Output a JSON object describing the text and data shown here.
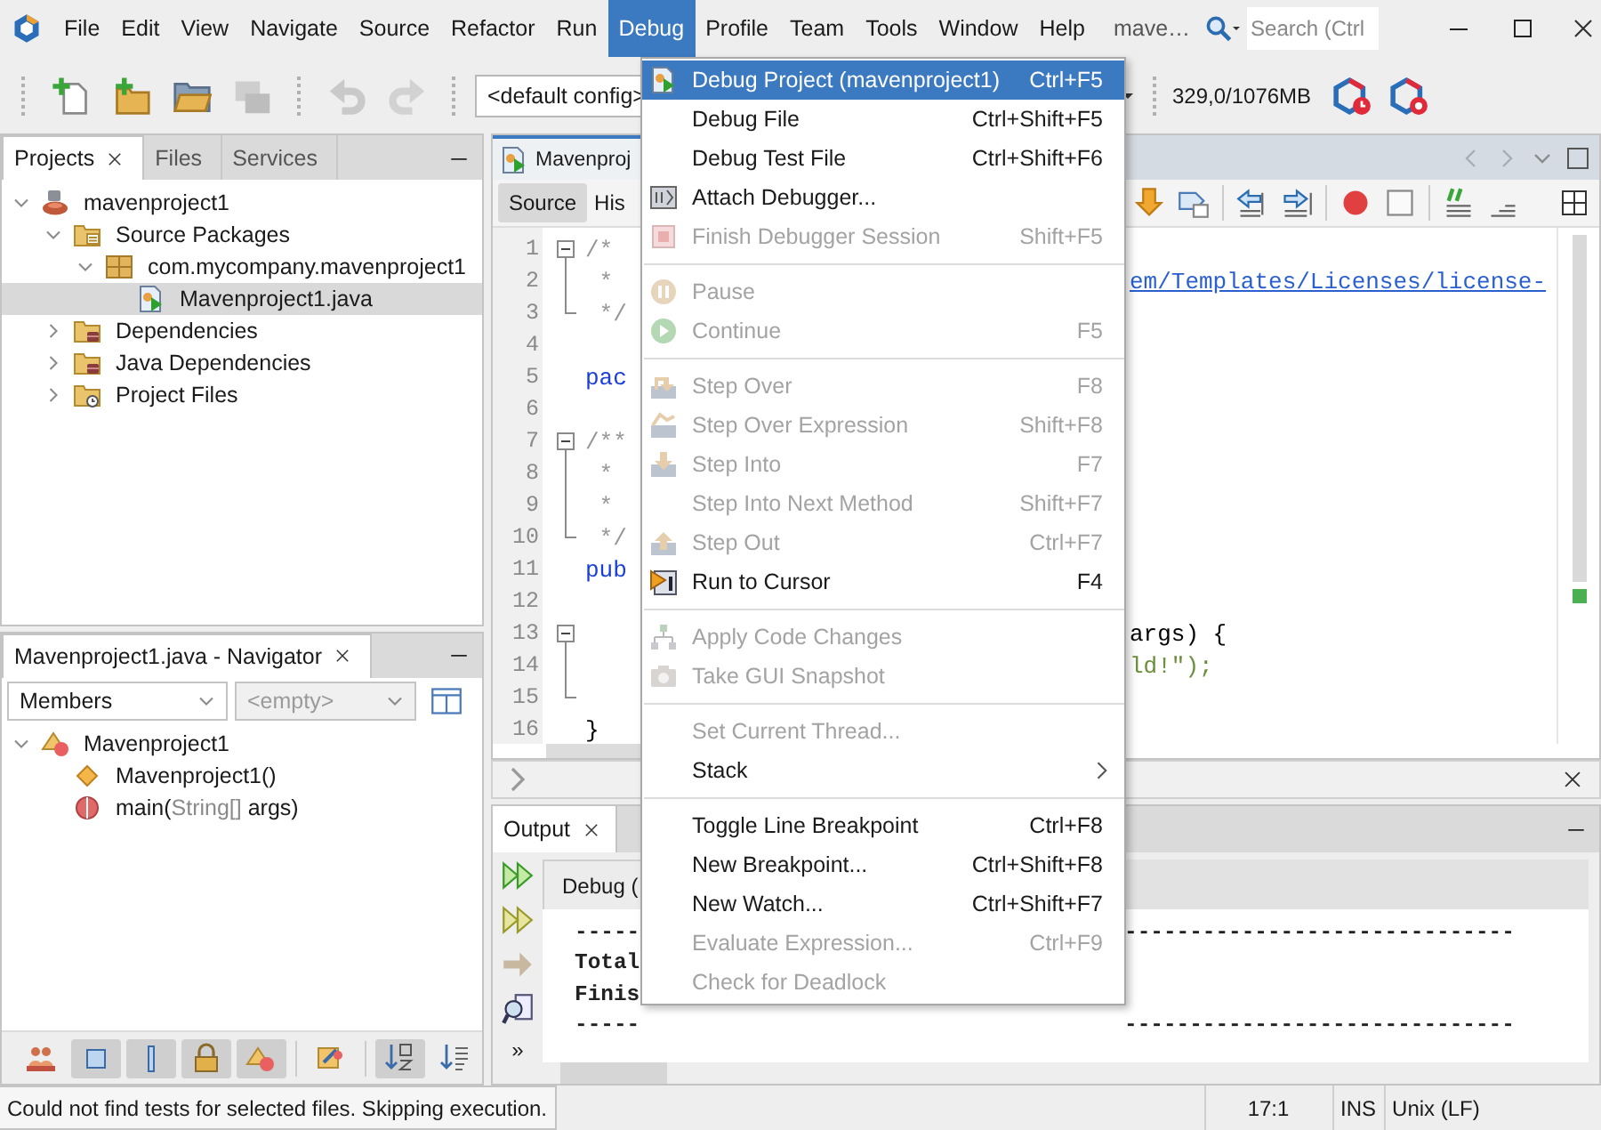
{
  "menubar": {
    "items": [
      {
        "label": "File",
        "selected": false
      },
      {
        "label": "Edit",
        "selected": false
      },
      {
        "label": "View",
        "selected": false
      },
      {
        "label": "Navigate",
        "selected": false
      },
      {
        "label": "Source",
        "selected": false
      },
      {
        "label": "Refactor",
        "selected": false
      },
      {
        "label": "Run",
        "selected": false
      },
      {
        "label": "Debug",
        "selected": true
      },
      {
        "label": "Profile",
        "selected": false
      },
      {
        "label": "Team",
        "selected": false
      },
      {
        "label": "Tools",
        "selected": false
      },
      {
        "label": "Window",
        "selected": false
      },
      {
        "label": "Help",
        "selected": false
      }
    ],
    "project_label": "mave…",
    "search": {
      "placeholder": "Search (Ctrl"
    }
  },
  "toolbar": {
    "buttons": [
      {
        "disabled": false
      },
      {
        "disabled": false
      },
      {
        "disabled": false
      },
      {
        "disabled": true
      },
      {
        "disabled": true
      },
      {
        "disabled": true
      }
    ],
    "config": "<default config>",
    "memory": "329,0/1076MB"
  },
  "projects_panel": {
    "tabs": [
      {
        "label": "Projects",
        "selected": true
      },
      {
        "label": "Files",
        "selected": false
      },
      {
        "label": "Services",
        "selected": false
      }
    ],
    "tree": [
      {
        "label": "mavenproject1",
        "kind": "project",
        "expanded": true,
        "selected": false,
        "children": [
          {
            "label": "Source Packages",
            "kind": "source-folder",
            "expanded": true,
            "selected": false,
            "children": [
              {
                "label": "com.mycompany.mavenproject1",
                "kind": "package",
                "expanded": true,
                "selected": false,
                "children": [
                  {
                    "label": "Mavenproject1.java",
                    "kind": "java-file",
                    "selected": true
                  }
                ]
              }
            ]
          },
          {
            "label": "Dependencies",
            "kind": "library-folder",
            "expanded": false,
            "selected": false
          },
          {
            "label": "Java Dependencies",
            "kind": "library-folder",
            "expanded": false,
            "selected": false
          },
          {
            "label": "Project Files",
            "kind": "config-folder",
            "expanded": false,
            "selected": false
          }
        ]
      }
    ]
  },
  "navigator": {
    "title": "Mavenproject1.java - Navigator",
    "filter": {
      "value": "Members",
      "disabled": false
    },
    "filter2": {
      "value": "<empty>",
      "disabled": true
    },
    "tree": [
      {
        "label": "Mavenproject1",
        "kind": "class",
        "expanded": true,
        "selected": false,
        "children": [
          {
            "label": "Mavenproject1()",
            "kind": "constructor",
            "selected": false
          },
          {
            "label": "main(",
            "param_type": "String[]",
            "param_rest": " args)",
            "kind": "method",
            "selected": false
          }
        ]
      }
    ],
    "tool_buttons": [
      {
        "on": false
      },
      {
        "on": true
      },
      {
        "on": true
      },
      {
        "on": true
      },
      {
        "on": true
      },
      {
        "on": false
      },
      {
        "on": true
      },
      {
        "on": false
      }
    ]
  },
  "editor": {
    "tab": "Mavenproj",
    "views": [
      {
        "label": "Source",
        "selected": true
      },
      {
        "label": "His",
        "selected": false
      }
    ],
    "lines": [
      {
        "number": "1",
        "kind": "fold-start",
        "left": {
          "text": "/*",
          "kind": "comment"
        }
      },
      {
        "number": "2",
        "kind": "fold-body",
        "left": {
          "text": " *",
          "kind": "comment"
        },
        "right": {
          "text": "em/Templates/Licenses/license-",
          "kind": "link"
        }
      },
      {
        "number": "3",
        "kind": "fold-end",
        "left": {
          "text": " */",
          "kind": "comment"
        }
      },
      {
        "number": "4",
        "kind": "plain"
      },
      {
        "number": "5",
        "kind": "plain",
        "left": {
          "text": "pac",
          "kind": "keyword"
        }
      },
      {
        "number": "6",
        "kind": "plain"
      },
      {
        "number": "7",
        "kind": "fold-start",
        "left": {
          "text": "/**",
          "kind": "comment"
        }
      },
      {
        "number": "8",
        "kind": "fold-body",
        "left": {
          "text": " *",
          "kind": "comment"
        }
      },
      {
        "number": "9",
        "kind": "fold-body",
        "left": {
          "text": " *",
          "kind": "comment"
        }
      },
      {
        "number": "10",
        "kind": "fold-end",
        "left": {
          "text": " */",
          "kind": "comment"
        }
      },
      {
        "number": "11",
        "kind": "plain",
        "left": {
          "text": "pub",
          "kind": "keyword"
        }
      },
      {
        "number": "12",
        "kind": "plain"
      },
      {
        "number": "13",
        "kind": "fold-start",
        "right": {
          "text": "args) {",
          "kind": "plain"
        }
      },
      {
        "number": "14",
        "kind": "fold-body",
        "right": {
          "text": "ld!\");",
          "kind": "string"
        }
      },
      {
        "number": "15",
        "kind": "fold-end"
      },
      {
        "number": "16",
        "kind": "plain",
        "left": {
          "text": "}",
          "kind": "plain"
        }
      }
    ]
  },
  "output": {
    "tab": "Output",
    "inner_tab": "Debug (",
    "more": "»",
    "lines": [
      {
        "left": "-----",
        "right": "------------------------------"
      },
      {
        "left": "Total"
      },
      {
        "left": "Finis"
      },
      {
        "left": "-----",
        "right": "------------------------------"
      }
    ]
  },
  "status_bar": {
    "message": "Could not find tests for selected files. Skipping execution.",
    "position": "17:1",
    "mode": "INS",
    "line_endings": "Unix (LF)"
  },
  "menu": {
    "items": [
      {
        "kind": "item",
        "label": "Debug Project (mavenproject1)",
        "shortcut": "Ctrl+F5",
        "icon": true,
        "disabled": false,
        "selected": true
      },
      {
        "kind": "item",
        "label": "Debug File",
        "shortcut": "Ctrl+Shift+F5",
        "icon": false,
        "disabled": false,
        "selected": false
      },
      {
        "kind": "item",
        "label": "Debug Test File",
        "shortcut": "Ctrl+Shift+F6",
        "icon": false,
        "disabled": false,
        "selected": false
      },
      {
        "kind": "item",
        "label": "Attach Debugger...",
        "icon": true,
        "disabled": false,
        "selected": false
      },
      {
        "kind": "item",
        "label": "Finish Debugger Session",
        "shortcut": "Shift+F5",
        "icon": true,
        "disabled": true,
        "selected": false
      },
      {
        "kind": "separator"
      },
      {
        "kind": "item",
        "label": "Pause",
        "icon": true,
        "disabled": true,
        "selected": false
      },
      {
        "kind": "item",
        "label": "Continue",
        "shortcut": "F5",
        "icon": true,
        "disabled": true,
        "selected": false
      },
      {
        "kind": "separator"
      },
      {
        "kind": "item",
        "label": "Step Over",
        "shortcut": "F8",
        "icon": true,
        "disabled": true,
        "selected": false
      },
      {
        "kind": "item",
        "label": "Step Over Expression",
        "shortcut": "Shift+F8",
        "icon": true,
        "disabled": true,
        "selected": false
      },
      {
        "kind": "item",
        "label": "Step Into",
        "shortcut": "F7",
        "icon": true,
        "disabled": true,
        "selected": false
      },
      {
        "kind": "item",
        "label": "Step Into Next Method",
        "shortcut": "Shift+F7",
        "icon": false,
        "disabled": true,
        "selected": false
      },
      {
        "kind": "item",
        "label": "Step Out",
        "shortcut": "Ctrl+F7",
        "icon": true,
        "disabled": true,
        "selected": false
      },
      {
        "kind": "item",
        "label": "Run to Cursor",
        "shortcut": "F4",
        "icon": true,
        "disabled": false,
        "selected": false
      },
      {
        "kind": "separator"
      },
      {
        "kind": "item",
        "label": "Apply Code Changes",
        "icon": true,
        "disabled": true,
        "selected": false
      },
      {
        "kind": "item",
        "label": "Take GUI Snapshot",
        "icon": true,
        "disabled": true,
        "selected": false
      },
      {
        "kind": "separator"
      },
      {
        "kind": "item",
        "label": "Set Current Thread...",
        "icon": false,
        "disabled": true,
        "selected": false
      },
      {
        "kind": "submenu",
        "label": "Stack",
        "icon": false,
        "disabled": false,
        "selected": false
      },
      {
        "kind": "separator"
      },
      {
        "kind": "item",
        "label": "Toggle Line Breakpoint",
        "shortcut": "Ctrl+F8",
        "icon": false,
        "disabled": false,
        "selected": false
      },
      {
        "kind": "item",
        "label": "New Breakpoint...",
        "shortcut": "Ctrl+Shift+F8",
        "icon": false,
        "disabled": false,
        "selected": false
      },
      {
        "kind": "item",
        "label": "New Watch...",
        "shortcut": "Ctrl+Shift+F7",
        "icon": false,
        "disabled": false,
        "selected": false
      },
      {
        "kind": "item",
        "label": "Evaluate Expression...",
        "shortcut": "Ctrl+F9",
        "icon": false,
        "disabled": true,
        "selected": false
      },
      {
        "kind": "item",
        "label": "Check for Deadlock",
        "icon": false,
        "disabled": true,
        "selected": false
      }
    ]
  }
}
